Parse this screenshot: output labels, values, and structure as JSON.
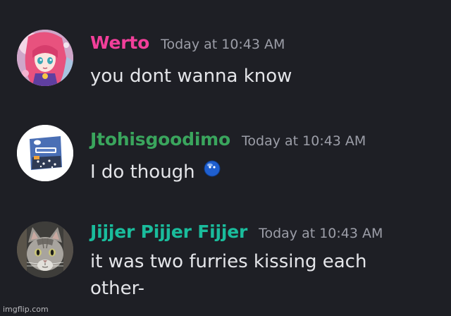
{
  "messages": [
    {
      "username": "Werto",
      "username_color": "#f23f9a",
      "timestamp": "Today at 10:43 AM",
      "text": "you dont wanna know",
      "avatar": "anime-girl-avatar"
    },
    {
      "username": "Jtohisgoodimo",
      "username_color": "#3aa55d",
      "timestamp": "Today at 10:43 AM",
      "text": "I do though",
      "emoji": "blue-ball-emoji",
      "avatar": "product-package-avatar"
    },
    {
      "username": "Jijjer Pijjer Fijjer",
      "username_color": "#1abc9c",
      "timestamp": "Today at 10:43 AM",
      "text_lines": [
        "it was two furries kissing each",
        "other-"
      ],
      "avatar": "cat-avatar"
    }
  ],
  "watermark": "imgflip.com"
}
